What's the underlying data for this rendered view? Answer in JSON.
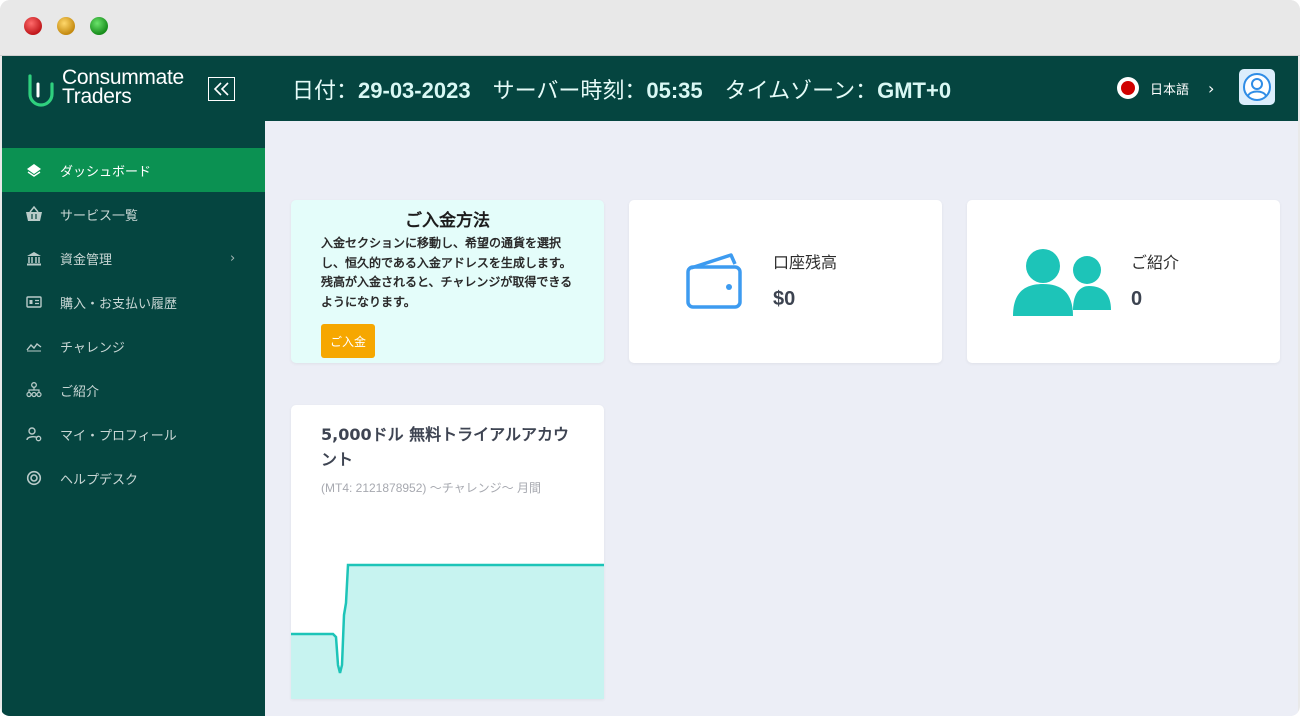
{
  "brand": {
    "line1": "Consummate",
    "line2": "Traders"
  },
  "header": {
    "date_label": "日付：",
    "date_value": "29-03-2023",
    "server_time_label": "サーバー時刻：",
    "server_time_value": "05:35",
    "timezone_label": "タイムゾーン：",
    "timezone_value": "GMT+0",
    "language": "日本語",
    "language_arrow": "›"
  },
  "sidebar": {
    "items": [
      {
        "label": "ダッシュボード",
        "icon": "diamond-icon",
        "active": true
      },
      {
        "label": "サービス一覧",
        "icon": "basket-icon"
      },
      {
        "label": "資金管理",
        "icon": "bank-icon",
        "chevron": "›"
      },
      {
        "label": "購入・お支払い履歴",
        "icon": "receipt-icon"
      },
      {
        "label": "チャレンジ",
        "icon": "trend-icon"
      },
      {
        "label": "ご紹介",
        "icon": "network-icon"
      },
      {
        "label": "マイ・プロフィール",
        "icon": "user-settings-icon"
      },
      {
        "label": "ヘルプデスク",
        "icon": "lifebuoy-icon"
      }
    ]
  },
  "deposit": {
    "title": "ご入金方法",
    "text": "入金セクションに移動し、希望の通貨を選択し、恒久的である入金アドレスを生成します。残高が入金されると、チャレンジが取得できるようになります。",
    "button": "ご入金"
  },
  "balance": {
    "label": "口座残高",
    "value": "$0",
    "icon": "wallet-icon"
  },
  "referral": {
    "label": "ご紹介",
    "value": "0",
    "icon": "users-icon"
  },
  "trial": {
    "title": "5,000ドル 無料トライアルアカウント",
    "subtitle": "(MT4: 2121878952) 〜チャレンジ〜 月間"
  },
  "colors": {
    "header_bg": "#054540",
    "active_nav": "#0b9152",
    "teal_accent": "#1dc4b8",
    "deposit_button": "#f6a700",
    "wallet_blue": "#3d9bf0"
  }
}
